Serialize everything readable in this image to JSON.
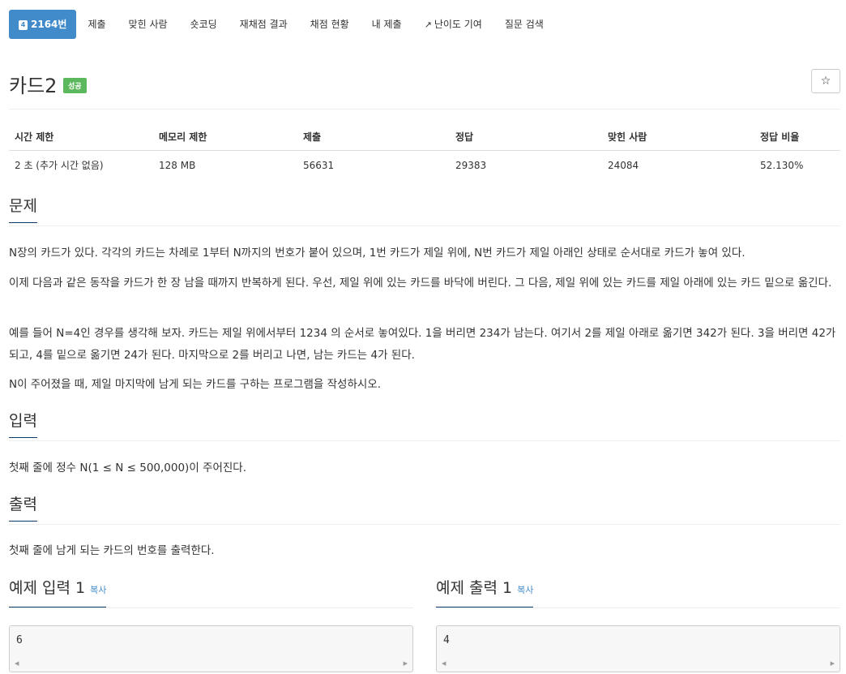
{
  "nav": {
    "problem_number": "2164번",
    "problem_icon": "4",
    "tabs": [
      "제출",
      "맞힌 사람",
      "숏코딩",
      "재채점 결과",
      "채점 현황",
      "내 제출",
      "난이도 기여",
      "질문 검색"
    ]
  },
  "problem": {
    "title": "카드2",
    "status": "성공",
    "star": "☆"
  },
  "info": {
    "headers": [
      "시간 제한",
      "메모리 제한",
      "제출",
      "정답",
      "맞힌 사람",
      "정답 비율"
    ],
    "values": [
      "2 초 (추가 시간 없음)",
      "128 MB",
      "56631",
      "29383",
      "24084",
      "52.130%"
    ]
  },
  "sections": {
    "problem_heading": "문제",
    "problem_paras": [
      "N장의 카드가 있다. 각각의 카드는 차례로 1부터 N까지의 번호가 붙어 있으며, 1번 카드가 제일 위에, N번 카드가 제일 아래인 상태로 순서대로 카드가 놓여 있다.",
      "이제 다음과 같은 동작을 카드가 한 장 남을 때까지 반복하게 된다. 우선, 제일 위에 있는 카드를 바닥에 버린다. 그 다음, 제일 위에 있는 카드를 제일 아래에 있는 카드 밑으로 옮긴다.",
      "예를 들어 N=4인 경우를 생각해 보자. 카드는 제일 위에서부터 1234 의 순서로 놓여있다. 1을 버리면 234가 남는다. 여기서 2를 제일 아래로 옮기면 342가 된다. 3을 버리면 42가 되고, 4를 밑으로 옮기면 24가 된다. 마지막으로 2를 버리고 나면, 남는 카드는 4가 된다.",
      "N이 주어졌을 때, 제일 마지막에 남게 되는 카드를 구하는 프로그램을 작성하시오."
    ],
    "input_heading": "입력",
    "input_text": "첫째 줄에 정수 N(1 ≤ N ≤ 500,000)이 주어진다.",
    "output_heading": "출력",
    "output_text": "첫째 줄에 남게 되는 카드의 번호를 출력한다.",
    "sample_input_heading": "예제 입력 1",
    "sample_output_heading": "예제 출력 1",
    "copy_label": "복사",
    "sample_input": "6",
    "sample_output": "4"
  }
}
